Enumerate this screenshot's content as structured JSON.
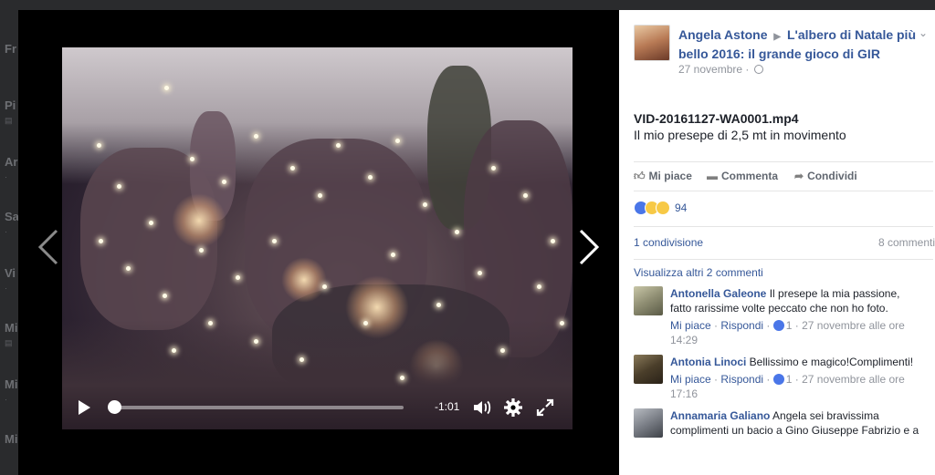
{
  "background": {
    "sidebar_letters": [
      {
        "letter": "Fr",
        "sub": ""
      },
      {
        "letter": "Pi",
        "sub": "▤"
      },
      {
        "letter": "Ar",
        "sub": "·"
      },
      {
        "letter": "Sa",
        "sub": "·"
      },
      {
        "letter": "Vi",
        "sub": "·"
      },
      {
        "letter": "Mi",
        "sub": "▤"
      },
      {
        "letter": "Mi",
        "sub": "·"
      },
      {
        "letter": "Mi",
        "sub": ""
      }
    ]
  },
  "video": {
    "time_remaining": "-1:01",
    "progress": 0.0,
    "icons": [
      "play-icon",
      "volume-icon",
      "settings-gear-icon",
      "fullscreen-icon"
    ]
  },
  "navigation": {
    "prev_icon": "chevron-left-icon",
    "next_icon": "chevron-right-icon"
  },
  "post": {
    "author": "Angela Astone",
    "separator": "▶",
    "group": "L'albero di Natale più bello 2016: il grande gioco di GIR",
    "date": "27 novembre",
    "date_separator": "·",
    "title": "VID-20161127-WA0001.mp4",
    "body": "Il mio presepe di 2,5 mt in movimento",
    "actions": {
      "like": "Mi piace",
      "comment": "Commenta",
      "share": "Condividi"
    },
    "reactions_count": "94",
    "share_count": "1 condivisione",
    "comment_count": "8 commenti",
    "more_comments": "Visualizza altri 2 commenti"
  },
  "comments": [
    {
      "name": "Antonella Galeone",
      "text": "Il presepe la mia passione, fatto rarissime volte peccato che non ho foto.",
      "like": "Mi piace",
      "reply": "Rispondi",
      "likes": "1",
      "timestamp": "27 novembre alle ore 14:29"
    },
    {
      "name": "Antonia Linoci",
      "text": "Bellissimo e magico!Complimenti!",
      "like": "Mi piace",
      "reply": "Rispondi",
      "likes": "1",
      "timestamp": "27 novembre alle ore 17:16"
    },
    {
      "name": "Annamaria Galiano",
      "text": "Angela sei bravissima complimenti un bacio a Gino Giuseppe Fabrizio e a",
      "like": "",
      "reply": "",
      "likes": "",
      "timestamp": ""
    }
  ],
  "colors": {
    "link": "#365899",
    "muted": "#90949c",
    "text": "#1d2129"
  }
}
